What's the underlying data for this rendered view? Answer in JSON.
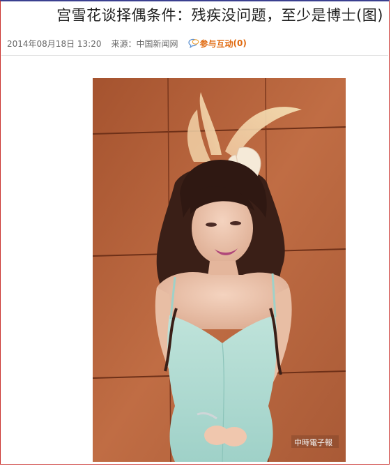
{
  "article": {
    "title": "宫雪花谈择偶条件：残疾没问题，至少是博士(图)",
    "date": "2014年08月18日 13:20",
    "source": "来源：中国新闻网",
    "interact_label": "参与互动",
    "interact_count": "(0)"
  },
  "photo": {
    "watermark": "中時電子報"
  },
  "icons": {
    "interact": "comment-bubble-icon"
  },
  "colors": {
    "border_red": "#c9302c",
    "top_bar": "#3a3f8f",
    "accent_orange": "#e06a10",
    "meta_gray": "#666666"
  }
}
